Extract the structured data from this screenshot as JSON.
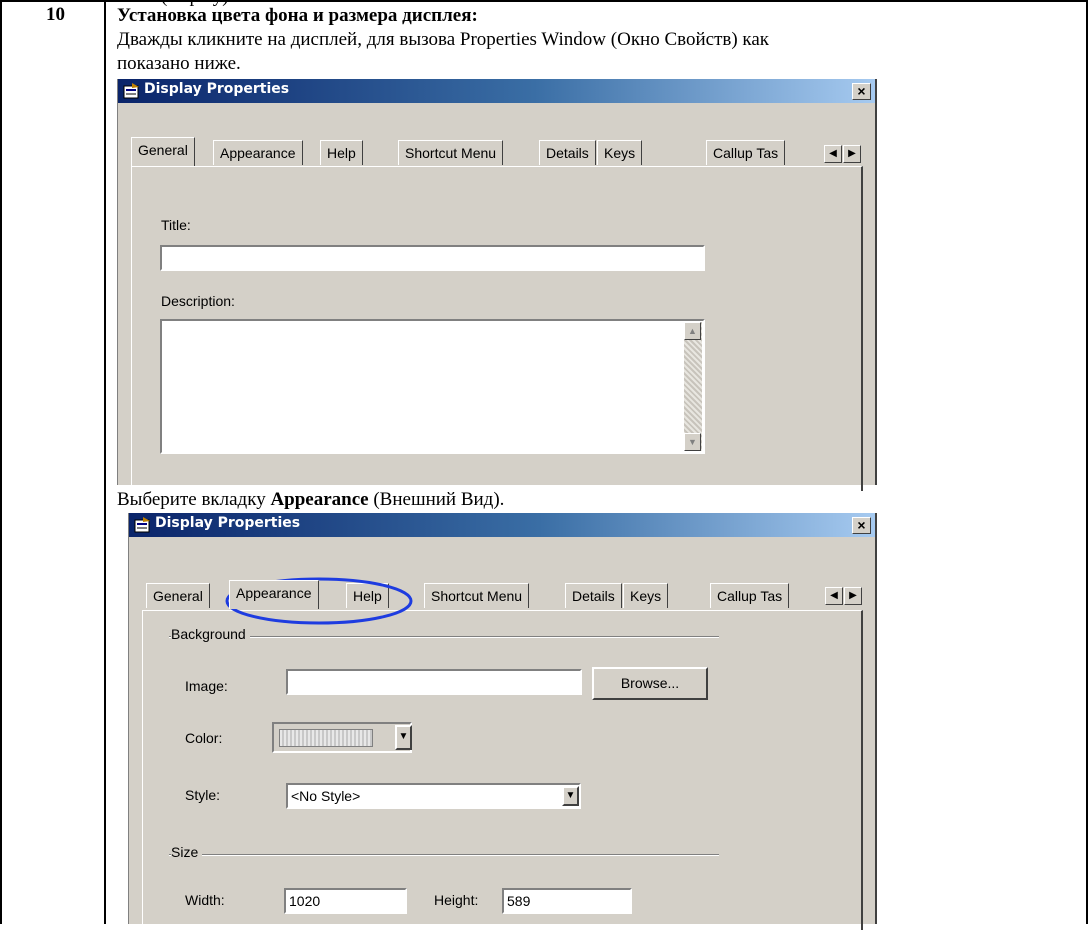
{
  "fragment_top": "(display)",
  "row_number": "10",
  "heading": "Установка цвета фона и размера дисплея:",
  "para1_line1": "Дважды кликните на дисплей, для вызова Properties Window (Окно Свойств) как",
  "para1_line2": "показано ниже.",
  "para2_prefix": "Выберите вкладку ",
  "para2_bold": "Appearance",
  "para2_suffix": " (Внешний Вид).",
  "dialog1": {
    "title": "Display Properties",
    "close": "×",
    "tabs": [
      "General",
      "Appearance",
      "Help",
      "Shortcut Menu",
      "Details",
      "Keys",
      "Callup Tas"
    ],
    "active_tab": "General",
    "title_label": "Title:",
    "title_value": "",
    "description_label": "Description:",
    "description_value": ""
  },
  "dialog2": {
    "title": "Display Properties",
    "close": "×",
    "tabs": [
      "General",
      "Appearance",
      "Help",
      "Shortcut Menu",
      "Details",
      "Keys",
      "Callup Tas"
    ],
    "active_tab": "Appearance",
    "highlight_color": "#1e3ce0",
    "background_group": "Background",
    "image_label": "Image:",
    "image_value": "",
    "browse_label": "Browse...",
    "color_label": "Color:",
    "style_label": "Style:",
    "style_value": "<No Style>",
    "size_group": "Size",
    "width_label": "Width:",
    "width_value": "1020",
    "height_label": "Height:",
    "height_value": "589"
  }
}
